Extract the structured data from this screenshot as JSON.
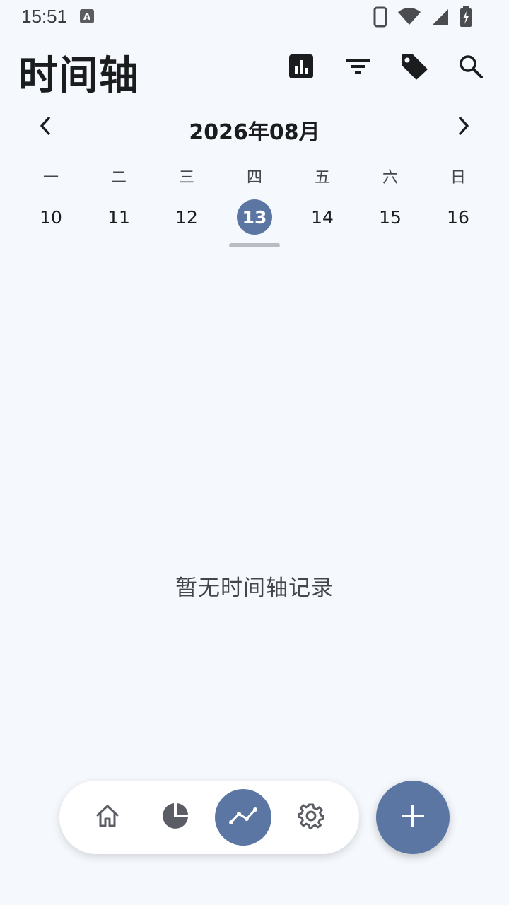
{
  "status_bar": {
    "time": "15:51"
  },
  "header": {
    "title": "时间轴",
    "actions": [
      "chart-icon",
      "filter-icon",
      "tag-icon",
      "search-icon"
    ]
  },
  "calendar": {
    "month_label": "2026年08月",
    "days": [
      {
        "weekday": "一",
        "date": "10",
        "selected": false
      },
      {
        "weekday": "二",
        "date": "11",
        "selected": false
      },
      {
        "weekday": "三",
        "date": "12",
        "selected": false
      },
      {
        "weekday": "四",
        "date": "13",
        "selected": true
      },
      {
        "weekday": "五",
        "date": "14",
        "selected": false
      },
      {
        "weekday": "六",
        "date": "15",
        "selected": false
      },
      {
        "weekday": "日",
        "date": "16",
        "selected": false
      }
    ]
  },
  "main": {
    "empty_text": "暂无时间轴记录"
  },
  "bottom_nav": {
    "items": [
      "home-icon",
      "pie-chart-icon",
      "timeline-icon",
      "settings-icon"
    ],
    "active": "timeline-icon"
  },
  "colors": {
    "accent": "#5c76a3",
    "background": "#f5f8fc"
  }
}
